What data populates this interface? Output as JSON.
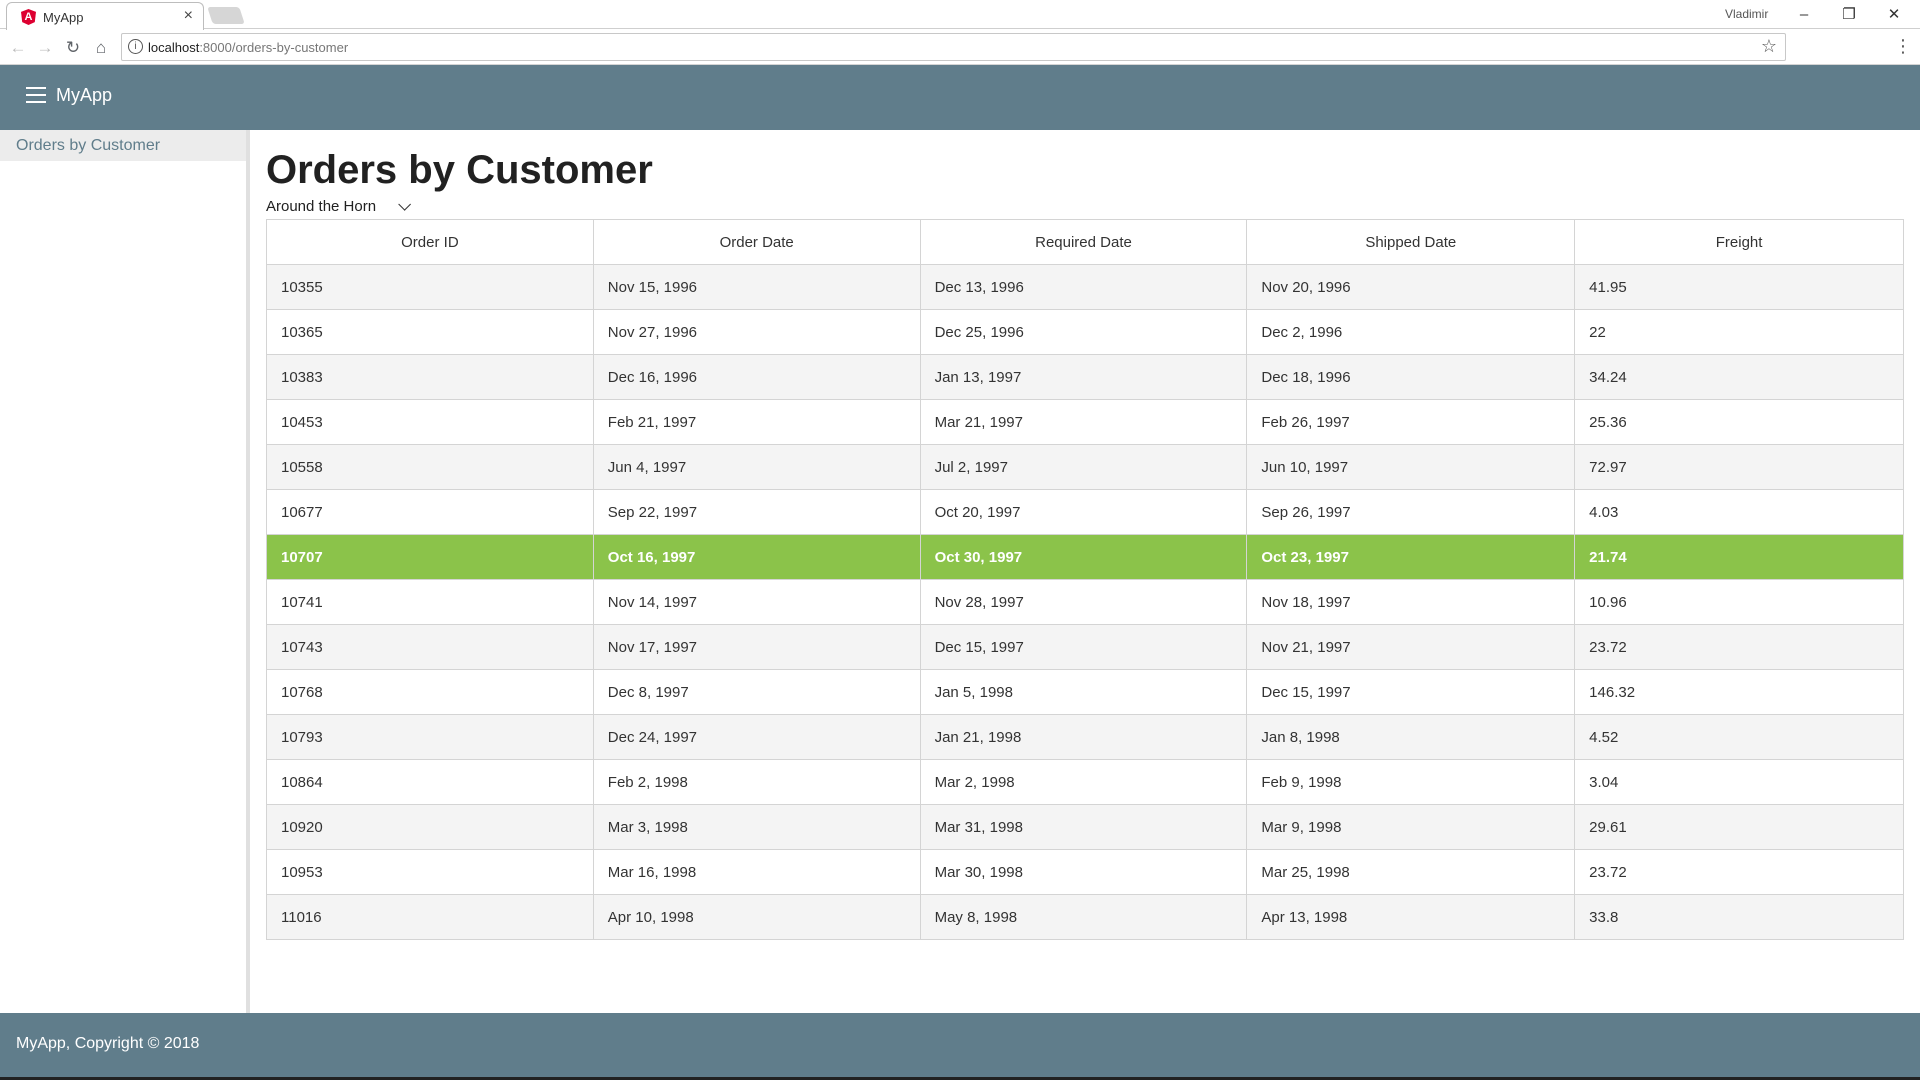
{
  "browser": {
    "tab_title": "MyApp",
    "tab_favicon": "A",
    "profile_name": "Vladimir",
    "url_host": "localhost",
    "url_path": ":8000/orders-by-customer",
    "controls": {
      "minimize": "–",
      "restore": "❐",
      "close": "✕",
      "tab_close": "×"
    }
  },
  "header": {
    "app_title": "MyApp"
  },
  "sidebar": {
    "items": [
      {
        "label": "Orders by Customer"
      }
    ]
  },
  "main": {
    "title": "Orders by Customer",
    "customer_select": "Around the Horn"
  },
  "table": {
    "columns": [
      "Order ID",
      "Order Date",
      "Required Date",
      "Shipped Date",
      "Freight"
    ],
    "selected_row": 6,
    "rows": [
      [
        "10355",
        "Nov 15, 1996",
        "Dec 13, 1996",
        "Nov 20, 1996",
        "41.95"
      ],
      [
        "10365",
        "Nov 27, 1996",
        "Dec 25, 1996",
        "Dec 2, 1996",
        "22"
      ],
      [
        "10383",
        "Dec 16, 1996",
        "Jan 13, 1997",
        "Dec 18, 1996",
        "34.24"
      ],
      [
        "10453",
        "Feb 21, 1997",
        "Mar 21, 1997",
        "Feb 26, 1997",
        "25.36"
      ],
      [
        "10558",
        "Jun 4, 1997",
        "Jul 2, 1997",
        "Jun 10, 1997",
        "72.97"
      ],
      [
        "10677",
        "Sep 22, 1997",
        "Oct 20, 1997",
        "Sep 26, 1997",
        "4.03"
      ],
      [
        "10707",
        "Oct 16, 1997",
        "Oct 30, 1997",
        "Oct 23, 1997",
        "21.74"
      ],
      [
        "10741",
        "Nov 14, 1997",
        "Nov 28, 1997",
        "Nov 18, 1997",
        "10.96"
      ],
      [
        "10743",
        "Nov 17, 1997",
        "Dec 15, 1997",
        "Nov 21, 1997",
        "23.72"
      ],
      [
        "10768",
        "Dec 8, 1997",
        "Jan 5, 1998",
        "Dec 15, 1997",
        "146.32"
      ],
      [
        "10793",
        "Dec 24, 1997",
        "Jan 21, 1998",
        "Jan 8, 1998",
        "4.52"
      ],
      [
        "10864",
        "Feb 2, 1998",
        "Mar 2, 1998",
        "Feb 9, 1998",
        "3.04"
      ],
      [
        "10920",
        "Mar 3, 1998",
        "Mar 31, 1998",
        "Mar 9, 1998",
        "29.61"
      ],
      [
        "10953",
        "Mar 16, 1998",
        "Mar 30, 1998",
        "Mar 25, 1998",
        "23.72"
      ],
      [
        "11016",
        "Apr 10, 1998",
        "May 8, 1998",
        "Apr 13, 1998",
        "33.8"
      ]
    ]
  },
  "footer": {
    "text": "MyApp, Copyright © 2018"
  },
  "colors": {
    "primary": "#607d8b",
    "selected": "#8bc34a",
    "stripe": "#f4f4f4"
  }
}
